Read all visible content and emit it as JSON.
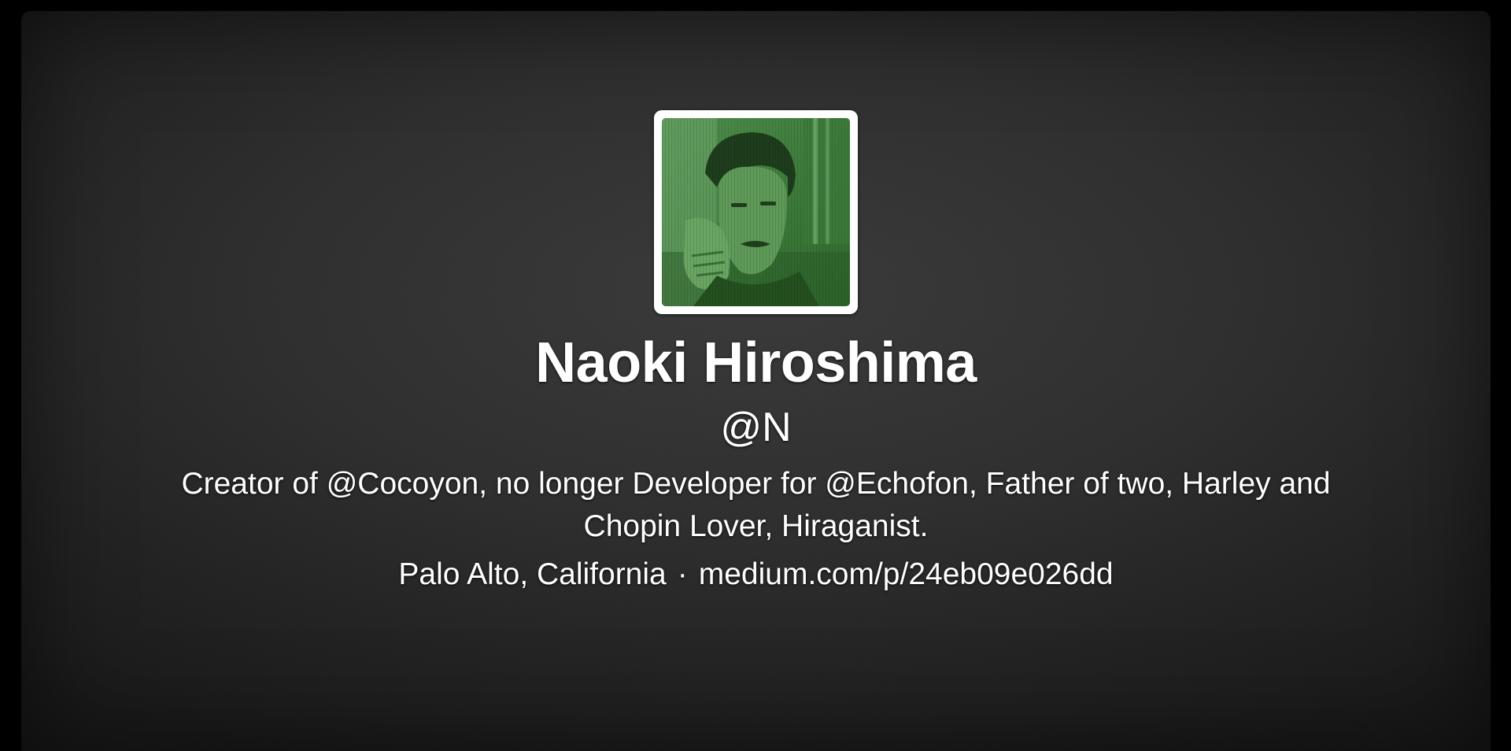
{
  "profile": {
    "name": "Naoki Hiroshima",
    "handle": "@N",
    "bio": "Creator of @Cocoyon, no longer Developer for @Echofon, Father of two, Harley and Chopin Lover, Hiraganist.",
    "location": "Palo Alto, California",
    "separator": "·",
    "url": "medium.com/p/24eb09e026dd"
  },
  "colors": {
    "text": "#ffffff",
    "avatar_tint": "#3f8a3f",
    "background": "#2f2f2f"
  }
}
